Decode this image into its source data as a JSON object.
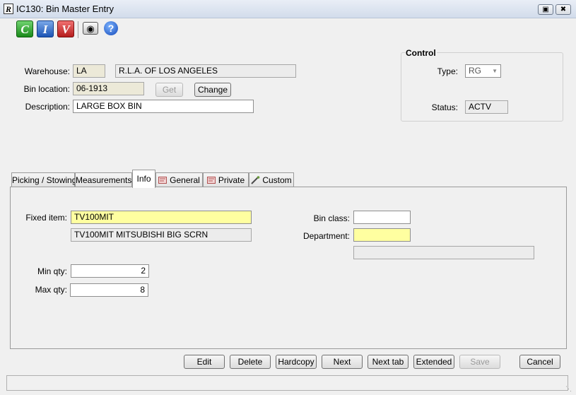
{
  "window": {
    "title": "IC130: Bin Master Entry",
    "app_icon": "R"
  },
  "toolbar": {
    "c_label": "C",
    "i_label": "I",
    "v_label": "V",
    "camera_icon": "camera-icon",
    "help_label": "?"
  },
  "form": {
    "warehouse_label": "Warehouse:",
    "warehouse_code": "LA",
    "warehouse_name": "R.L.A. OF LOS ANGELES",
    "bin_location_label": "Bin location:",
    "bin_location": "06-1913",
    "get_label": "Get",
    "change_label": "Change",
    "description_label": "Description:",
    "description": "LARGE BOX BIN"
  },
  "control": {
    "title": "Control",
    "type_label": "Type:",
    "type_value": "RG",
    "status_label": "Status:",
    "status_value": "ACTV"
  },
  "tabs": [
    {
      "label": "Picking / Stowing"
    },
    {
      "label": "Measurements"
    },
    {
      "label": "Info",
      "active": true
    },
    {
      "label": "General"
    },
    {
      "label": "Private"
    },
    {
      "label": "Custom"
    }
  ],
  "info": {
    "fixed_item_label": "Fixed item:",
    "fixed_item": "TV100MIT",
    "fixed_item_desc": "TV100MIT MITSUBISHI BIG SCRN",
    "min_qty_label": "Min qty:",
    "min_qty": "2",
    "max_qty_label": "Max qty:",
    "max_qty": "8",
    "bin_class_label": "Bin class:",
    "bin_class": "",
    "department_label": "Department:",
    "department": "",
    "department_desc": ""
  },
  "buttons": {
    "edit": "Edit",
    "delete": "Delete",
    "hardcopy": "Hardcopy",
    "next": "Next",
    "next_tab": "Next tab",
    "extended": "Extended",
    "save": "Save",
    "cancel": "Cancel"
  },
  "status_bar": {
    "text": ""
  }
}
